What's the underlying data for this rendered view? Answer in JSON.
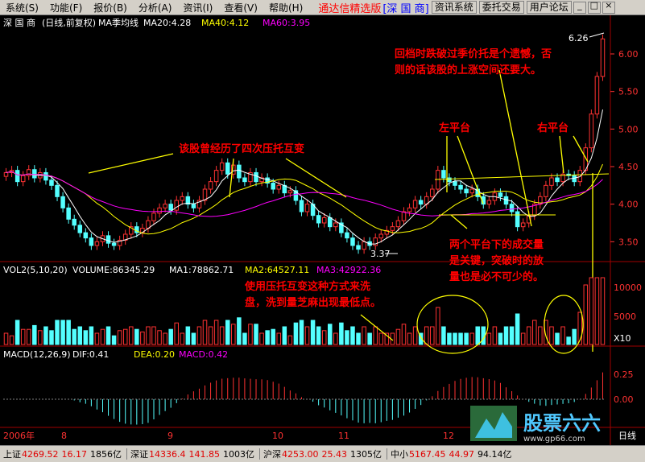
{
  "menu": {
    "items": [
      "系统(S)",
      "功能(F)",
      "报价(B)",
      "分析(A)",
      "资讯(I)",
      "查看(V)",
      "帮助(H)"
    ],
    "title": "通达信精选版",
    "stock_tag": "[深 国 商]",
    "buttons": [
      "资讯系统",
      "委托交易",
      "用户论坛"
    ]
  },
  "header": {
    "stock": "深 国 商",
    "mode": "(日线,前复权)",
    "ma_label": "MA季均线",
    "ma20": "MA20:4.28",
    "ma40": "MA40:4.12",
    "ma60": "MA60:3.95"
  },
  "price_axis": [
    "6.00",
    "5.50",
    "5.00",
    "4.50",
    "4.00",
    "3.50"
  ],
  "price_marks": {
    "high": "6.26",
    "low": "3.37"
  },
  "volume": {
    "label": "VOL2(5,10,20)",
    "volume": "VOLUME:86345.29",
    "ma1": "MA1:78862.71",
    "ma2": "MA2:64527.11",
    "ma3": "MA3:42922.36",
    "axis": [
      "10000",
      "5000",
      "X10"
    ]
  },
  "macd": {
    "label": "MACD(12,26,9)",
    "dif": "DIF:0.41",
    "dea": "DEA:0.20",
    "macd": "MACD:0.42",
    "axis": [
      "0.25",
      "0.00"
    ]
  },
  "date_axis": {
    "start": "2006年",
    "months": [
      "8",
      "9",
      "10",
      "11",
      "12"
    ],
    "period": "日线"
  },
  "annotations": {
    "top_right": [
      "回档时跌破过季价托是个遗憾，否",
      "则的话该股的上涨空间还要大。"
    ],
    "left_platform": "左平台",
    "right_platform": "右平台",
    "mid_note": "该股曾经历了四次压托互变",
    "bottom_right": [
      "两个平台下的成交量",
      "是关键，突破时的放",
      "量也是必不可少的。"
    ],
    "volume_note": [
      "使用压托互变这种方式来洗",
      "盘，洗到量芝麻出现最低点。"
    ]
  },
  "status": {
    "sh_label": "上证",
    "sh_value": "4269.52",
    "sh_change": "16.17",
    "sh_amount": "1856亿",
    "sz_label": "深证",
    "sz_value": "14336.4",
    "sz_change": "141.85",
    "sz_amount": "1003亿",
    "hs_label": "沪深",
    "hs_value": "4253.00",
    "hs_change": "25.43",
    "hs_amount": "1305亿",
    "zx_label": "中小",
    "zx_value": "5167.45",
    "zx_change": "44.97",
    "zx_amount": "94.14亿"
  },
  "logo": {
    "text": "股票六六",
    "url": "www.gp66.com"
  },
  "colors": {
    "up": "#ff3232",
    "down": "#54ffff",
    "ma_white": "#ffffff",
    "ma_yellow": "#ffff00",
    "ma_magenta": "#ff00ff",
    "annotation": "#ff0000",
    "arrow": "#ffff00"
  },
  "chart_data": {
    "type": "candlestick",
    "price_range": [
      3.3,
      6.3
    ],
    "closes": [
      4.42,
      4.45,
      4.3,
      4.38,
      4.46,
      4.35,
      4.42,
      4.32,
      4.25,
      4.1,
      3.95,
      3.8,
      3.72,
      3.62,
      3.55,
      3.45,
      3.5,
      3.58,
      3.48,
      3.45,
      3.52,
      3.6,
      3.7,
      3.62,
      3.68,
      3.78,
      3.88,
      3.95,
      4.0,
      3.92,
      4.05,
      4.1,
      4.0,
      3.95,
      4.05,
      4.2,
      4.3,
      4.45,
      4.55,
      4.4,
      4.52,
      4.35,
      4.3,
      4.42,
      4.3,
      4.35,
      4.28,
      4.2,
      4.25,
      4.15,
      4.18,
      4.05,
      3.9,
      4.0,
      3.85,
      3.75,
      3.82,
      3.7,
      3.75,
      3.62,
      3.55,
      3.45,
      3.4,
      3.5,
      3.45,
      3.55,
      3.6,
      3.65,
      3.7,
      3.78,
      3.9,
      3.95,
      4.05,
      4.0,
      4.1,
      4.2,
      4.45,
      4.35,
      4.3,
      4.25,
      4.2,
      4.15,
      4.2,
      4.1,
      4.0,
      4.05,
      4.15,
      4.1,
      4.0,
      3.9,
      3.7,
      3.75,
      3.85,
      4.0,
      4.1,
      4.25,
      4.35,
      4.3,
      4.4,
      4.38,
      4.3,
      4.45,
      4.75,
      5.2,
      5.7,
      6.2
    ]
  }
}
